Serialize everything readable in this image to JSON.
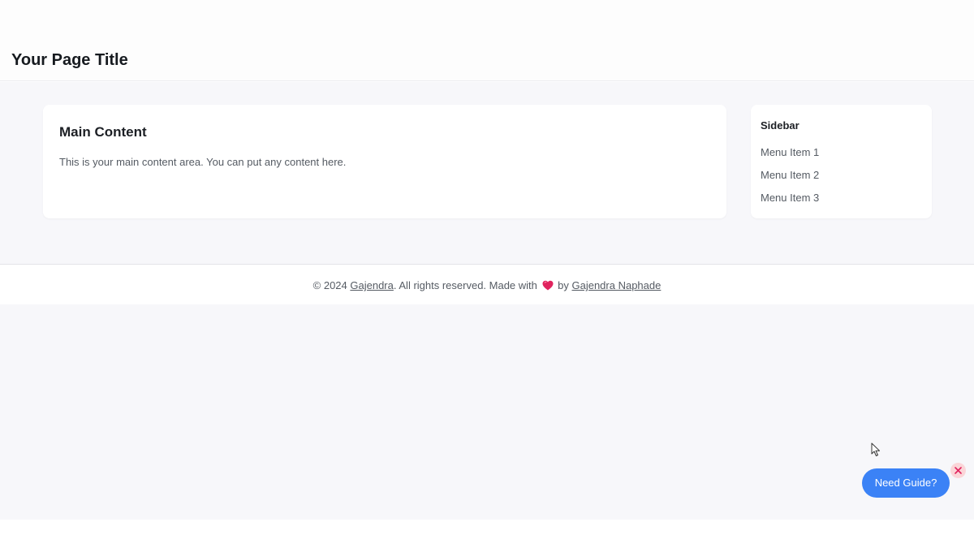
{
  "header": {
    "title": "Your Page Title"
  },
  "main": {
    "heading": "Main Content",
    "text": "This is your main content area. You can put any content here."
  },
  "sidebar": {
    "heading": "Sidebar",
    "items": [
      {
        "label": "Menu Item 1"
      },
      {
        "label": "Menu Item 2"
      },
      {
        "label": "Menu Item 3"
      }
    ]
  },
  "footer": {
    "prefix": "© 2024 ",
    "brand_link": "Gajendra",
    "middle": ". All rights reserved. Made with ",
    "by": " by ",
    "author_link": "Gajendra Naphade",
    "heart_icon": "heart-icon",
    "heart_color": "#e0245e"
  },
  "guide": {
    "button_label": "Need Guide?",
    "button_color": "#3b82f6",
    "close_icon": "close-icon",
    "close_color": "#e0245e"
  }
}
